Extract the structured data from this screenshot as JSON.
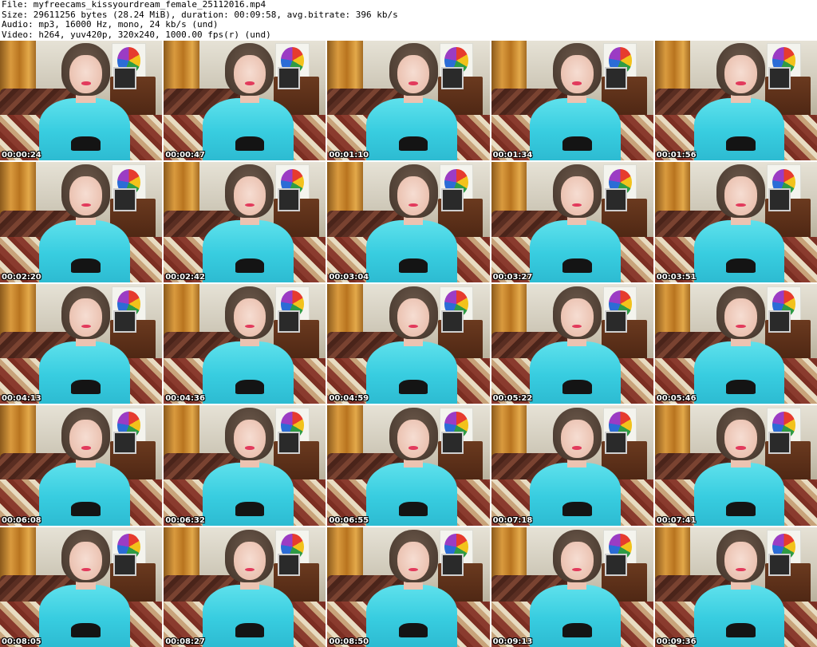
{
  "header": {
    "file": "File: myfreecams_kissyourdream_female_25112016.mp4",
    "size": "Size: 29611256 bytes (28.24 MiB), duration: 00:09:58, avg.bitrate: 396 kb/s",
    "audio": "Audio: mp3, 16000 Hz, mono, 24 kb/s (und)",
    "video": "Video: h264, yuv420p, 320x240, 1000.00 fps(r) (und)"
  },
  "thumbnails": [
    {
      "time": "00:00:24"
    },
    {
      "time": "00:00:47"
    },
    {
      "time": "00:01:10"
    },
    {
      "time": "00:01:34"
    },
    {
      "time": "00:01:56"
    },
    {
      "time": "00:02:20"
    },
    {
      "time": "00:02:42"
    },
    {
      "time": "00:03:04"
    },
    {
      "time": "00:03:27"
    },
    {
      "time": "00:03:51"
    },
    {
      "time": "00:04:13"
    },
    {
      "time": "00:04:36"
    },
    {
      "time": "00:04:59"
    },
    {
      "time": "00:05:22"
    },
    {
      "time": "00:05:46"
    },
    {
      "time": "00:06:08"
    },
    {
      "time": "00:06:32"
    },
    {
      "time": "00:06:55"
    },
    {
      "time": "00:07:18"
    },
    {
      "time": "00:07:41"
    },
    {
      "time": "00:08:05"
    },
    {
      "time": "00:08:27"
    },
    {
      "time": "00:08:50"
    },
    {
      "time": "00:09:13"
    },
    {
      "time": "00:09:36"
    }
  ]
}
